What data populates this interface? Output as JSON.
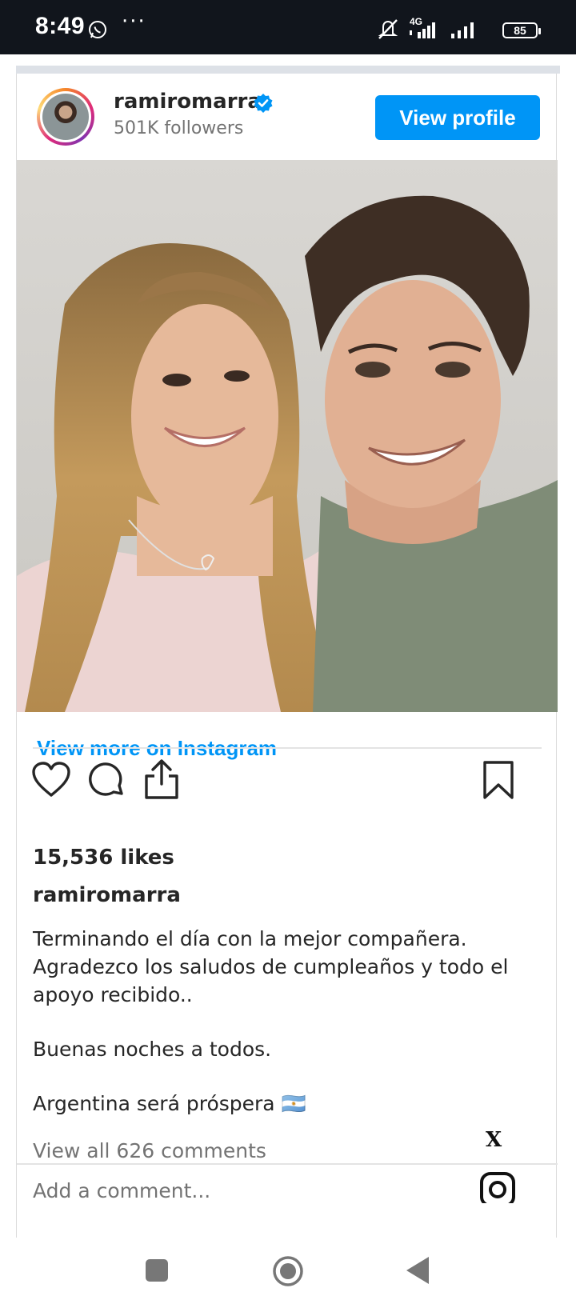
{
  "status_bar": {
    "time": "8:49",
    "dots": "···",
    "network": "4G",
    "battery": "85",
    "icons": [
      "whatsapp-icon",
      "mute-icon",
      "signal-icon",
      "battery-icon"
    ]
  },
  "post": {
    "username": "ramiromarra",
    "followers": "501K followers",
    "view_profile_label": "View profile",
    "view_more_label": "View more on Instagram",
    "likes": "15,536 likes",
    "caption_user": "ramiromarra",
    "caption_lines": [
      "Terminando el día con la mejor compañera.",
      "Agradezco los saludos de cumpleaños y todo el apoyo recibido..",
      "Buenas noches a todos.",
      "Argentina será próspera 🇦🇷"
    ],
    "view_comments_label": "View all 626 comments",
    "add_comment_placeholder": "Add a comment...",
    "close_label": "X"
  },
  "colors": {
    "accent": "#0095f6",
    "status_bar": "#11151c",
    "text": "#262626",
    "muted": "#737373"
  },
  "nav": {
    "buttons": [
      "recents-button",
      "home-button",
      "back-button"
    ]
  }
}
